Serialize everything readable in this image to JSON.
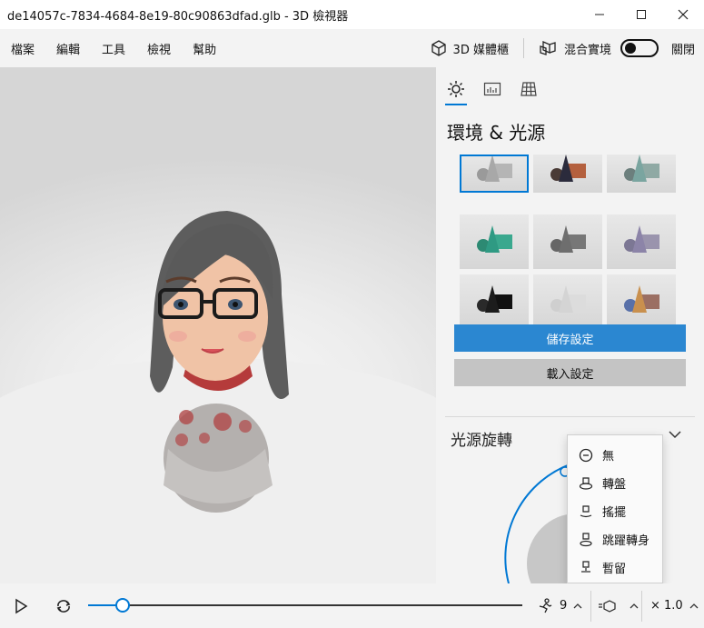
{
  "window": {
    "title": "de14057c-7834-4684-8e19-80c90863dfad.glb - 3D 檢視器",
    "minimize": "—",
    "maximize": "☐",
    "close": "✕"
  },
  "menu": {
    "items": [
      "檔案",
      "編輯",
      "工具",
      "檢視",
      "幫助"
    ],
    "library_label": "3D 媒體櫃",
    "mixed_reality_label": "混合實境",
    "toggle_state_label": "關閉"
  },
  "panel": {
    "title": "環境 & 光源",
    "save_label": "儲存設定",
    "load_label": "載入設定",
    "rotation_title": "光源旋轉"
  },
  "thumbnails": [
    {
      "cone": "#a8a8a8",
      "box": "#b5b5b5",
      "ball": "#9a9a9a"
    },
    {
      "cone": "#2b2b3c",
      "box": "#b4603e",
      "ball": "#4a3b36"
    },
    {
      "cone": "#7aa5a0",
      "box": "#8fa9a4",
      "ball": "#6c7f7d"
    },
    {
      "cone": "#2f9a83",
      "box": "#3aa88e",
      "ball": "#2d8a73"
    },
    {
      "cone": "#6e6e6e",
      "box": "#777777",
      "ball": "#666666"
    },
    {
      "cone": "#8c84a8",
      "box": "#9a94ad",
      "ball": "#7c7794"
    },
    {
      "cone": "#1c1c1c",
      "box": "#111111",
      "ball": "#2a2a2a"
    },
    {
      "cone": "#d4d4d4",
      "box": "#dcdcdc",
      "ball": "#cfcfcf"
    },
    {
      "cone": "#c9904e",
      "box": "#9b6f63",
      "ball": "#5870a8"
    }
  ],
  "dropdown": {
    "items": [
      {
        "label": "無",
        "icon": "minus-circle-icon"
      },
      {
        "label": "轉盤",
        "icon": "turntable-icon"
      },
      {
        "label": "搖擺",
        "icon": "swing-icon"
      },
      {
        "label": "跳躍轉身",
        "icon": "jump-turn-icon"
      },
      {
        "label": "暫留",
        "icon": "hover-icon"
      }
    ]
  },
  "playback": {
    "animation_count": "9",
    "speed": "× 1.0",
    "progress": 0.08
  },
  "colors": {
    "accent": "#0078d4",
    "save_button": "#2b87d1",
    "load_button": "#c4c4c4"
  }
}
